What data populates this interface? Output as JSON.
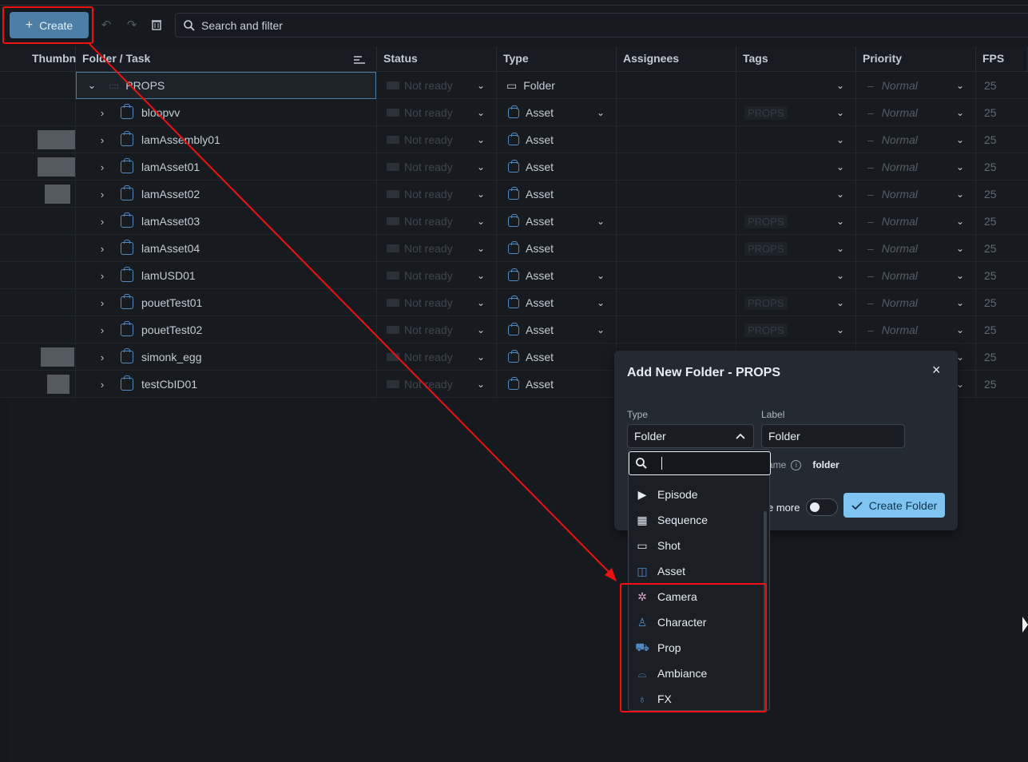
{
  "toolbar": {
    "create_label": "Create",
    "search_placeholder": "Search and filter"
  },
  "columns": [
    "Thumbn",
    "Folder / Task",
    "Status",
    "Type",
    "Assignees",
    "Tags",
    "Priority",
    "FPS"
  ],
  "rows": [
    {
      "name": "PROPS",
      "status": "Not ready",
      "type": "Folder",
      "tag": "",
      "priority": "Normal",
      "fps": "25"
    },
    {
      "name": "bloopvv",
      "status": "Not ready",
      "type": "Asset",
      "tag": "PROPS",
      "priority": "Normal",
      "fps": "25"
    },
    {
      "name": "lamAssembly01",
      "status": "Not ready",
      "type": "Asset",
      "tag": "",
      "priority": "Normal",
      "fps": "25"
    },
    {
      "name": "lamAsset01",
      "status": "Not ready",
      "type": "Asset",
      "tag": "",
      "priority": "Normal",
      "fps": "25"
    },
    {
      "name": "lamAsset02",
      "status": "Not ready",
      "type": "Asset",
      "tag": "",
      "priority": "Normal",
      "fps": "25"
    },
    {
      "name": "lamAsset03",
      "status": "Not ready",
      "type": "Asset",
      "tag": "PROPS",
      "priority": "Normal",
      "fps": "25"
    },
    {
      "name": "lamAsset04",
      "status": "Not ready",
      "type": "Asset",
      "tag": "PROPS",
      "priority": "Normal",
      "fps": "25"
    },
    {
      "name": "lamUSD01",
      "status": "Not ready",
      "type": "Asset",
      "tag": "",
      "priority": "Normal",
      "fps": "25"
    },
    {
      "name": "pouetTest01",
      "status": "Not ready",
      "type": "Asset",
      "tag": "PROPS",
      "priority": "Normal",
      "fps": "25"
    },
    {
      "name": "pouetTest02",
      "status": "Not ready",
      "type": "Asset",
      "tag": "PROPS",
      "priority": "Normal",
      "fps": "25"
    },
    {
      "name": "simonk_egg",
      "status": "Not ready",
      "type": "Asset",
      "tag": "",
      "priority": "",
      "fps": "25"
    },
    {
      "name": "testCbID01",
      "status": "Not ready",
      "type": "Asset",
      "tag": "",
      "priority": "",
      "fps": "25"
    }
  ],
  "modal": {
    "title": "Add New Folder - PROPS",
    "close": "×",
    "type_label": "Type",
    "type_value": "Folder",
    "label_label": "Label",
    "label_value": "Folder",
    "name_prefix": "ame",
    "name_value": "folder",
    "more_label": "e more",
    "create_label": "Create Folder"
  },
  "dropdown": {
    "options": [
      {
        "label": "Episode",
        "icon": "episode-icon"
      },
      {
        "label": "Sequence",
        "icon": "sequence-icon"
      },
      {
        "label": "Shot",
        "icon": "shot-icon"
      },
      {
        "label": "Asset",
        "icon": "asset-icon"
      },
      {
        "label": "Camera",
        "icon": "camera-icon"
      },
      {
        "label": "Character",
        "icon": "character-icon"
      },
      {
        "label": "Prop",
        "icon": "prop-icon"
      },
      {
        "label": "Ambiance",
        "icon": "ambiance-icon"
      },
      {
        "label": "FX",
        "icon": "fx-icon"
      }
    ]
  },
  "colors": {
    "accent": "#4d7fa6",
    "create_folder_bg": "#7fc4f0",
    "annotation": "#ee1111",
    "asset_icon": "#4e8ac4"
  }
}
